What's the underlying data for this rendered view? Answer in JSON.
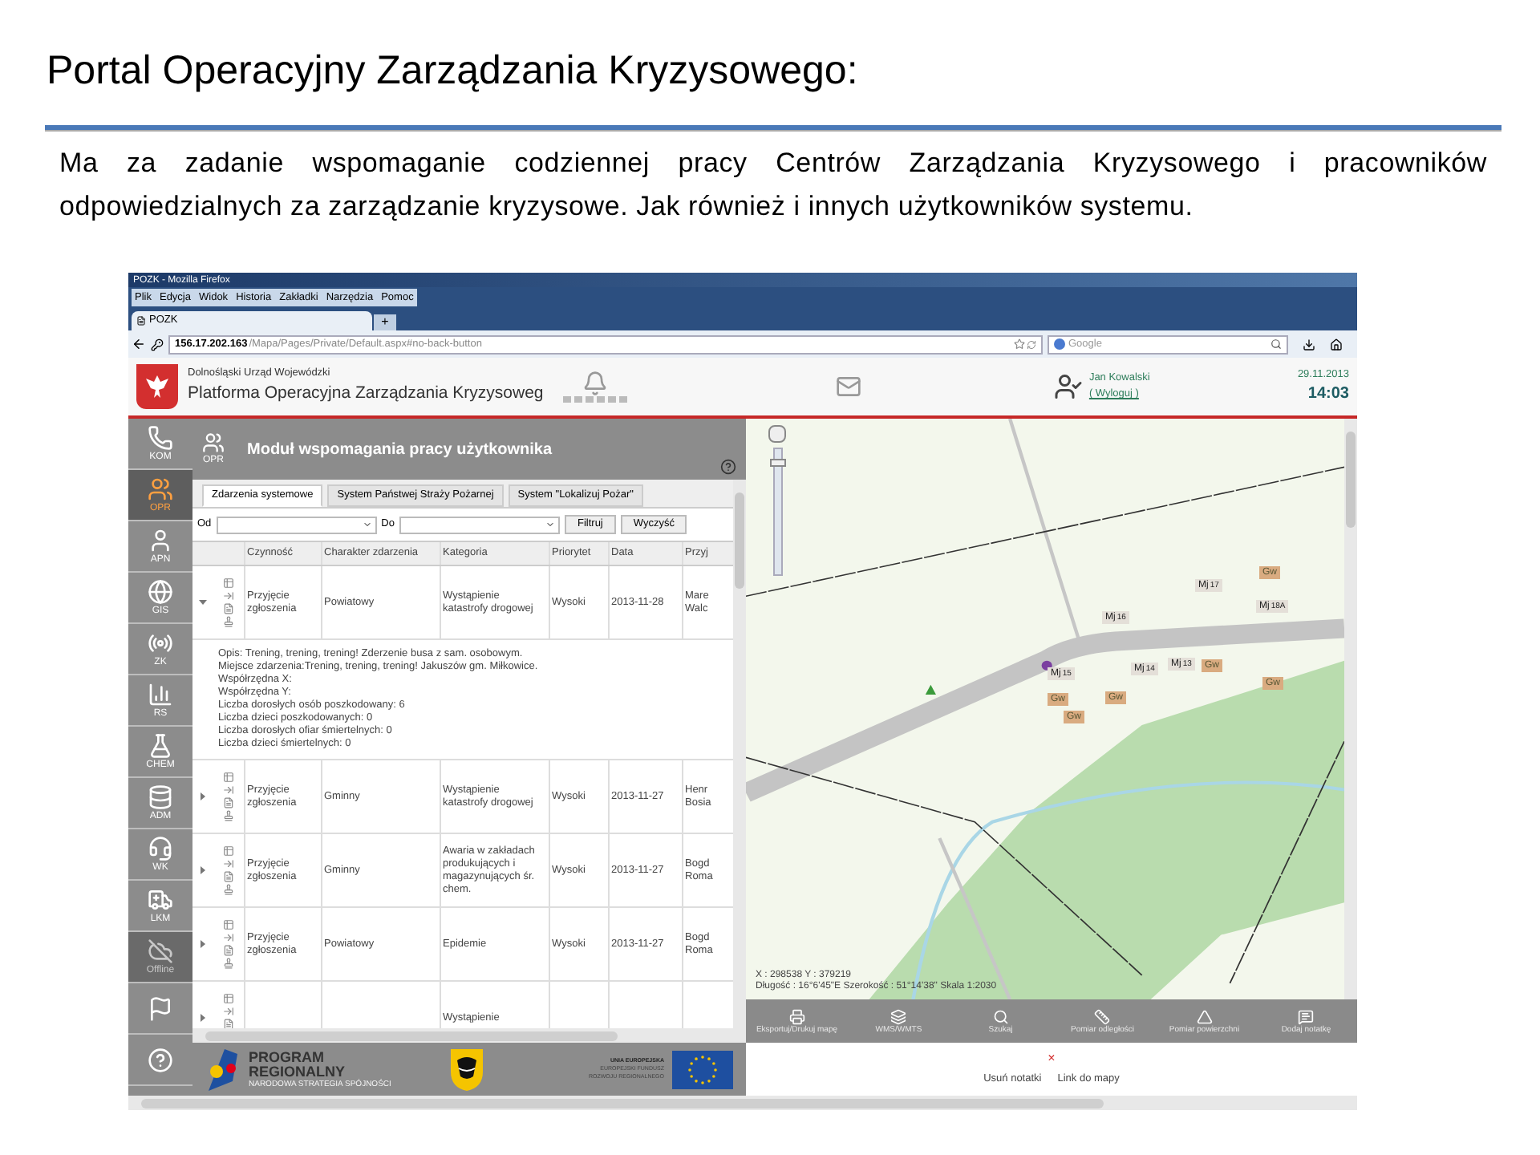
{
  "slide": {
    "title": "Portal Operacyjny Zarządzania Kryzysowego:",
    "paragraph": "Ma za zadanie wspomaganie codziennej pracy Centrów Zarządzania Kryzysowego i pracowników odpowiedzialnych za zarządzanie kryzysowe. Jak również i innych użytkowników systemu."
  },
  "browser": {
    "title": "POZK - Mozilla Firefox",
    "menu": [
      "Plik",
      "Edycja",
      "Widok",
      "Historia",
      "Zakładki",
      "Narzędzia",
      "Pomoc"
    ],
    "tab": "POZK",
    "new_tab": "+",
    "url_host": "156.17.202.163",
    "url_path": "/Mapa/Pages/Private/Default.aspx#no-back-button",
    "search_placeholder": "Google"
  },
  "header": {
    "org_words": [
      "Dolnośląski",
      "Urząd",
      "Wojewódzki"
    ],
    "platform_words": [
      "Platforma",
      "Operacyjna",
      "Zarządzania",
      "Kryzysoweg"
    ],
    "user": "Jan Kowalski",
    "logout": "( Wyloguj )",
    "date": "29.11.2013",
    "time": "14:03"
  },
  "sidebar": {
    "items": [
      {
        "label": "KOM",
        "selected": false,
        "disabled": false
      },
      {
        "label": "OPR",
        "selected": true,
        "disabled": false
      },
      {
        "label": "APN",
        "selected": false,
        "disabled": false
      },
      {
        "label": "GIS",
        "selected": false,
        "disabled": false
      },
      {
        "label": "ZK",
        "selected": false,
        "disabled": false
      },
      {
        "label": "RS",
        "selected": false,
        "disabled": false
      },
      {
        "label": "CHEM",
        "selected": false,
        "disabled": false
      },
      {
        "label": "ADM",
        "selected": false,
        "disabled": false
      },
      {
        "label": "WK",
        "selected": false,
        "disabled": false
      },
      {
        "label": "LKM",
        "selected": false,
        "disabled": false
      },
      {
        "label": "Offline",
        "selected": false,
        "disabled": true
      },
      {
        "selected": false,
        "disabled": false
      },
      {
        "selected": false,
        "disabled": false
      }
    ]
  },
  "module": {
    "icon_label": "OPR",
    "title": "Moduł wspomagania pracy użytkownika",
    "tabs": [
      {
        "label": "Zdarzenia systemowe",
        "selected": true
      },
      {
        "label": "System Państwej Straży Pożarnej",
        "selected": false
      },
      {
        "label": "System \"Lokalizuj Pożar\"",
        "selected": false
      }
    ],
    "filter": {
      "from_label": "Od",
      "to_label": "Do",
      "buttons": [
        "Filtruj",
        "Wyczyść"
      ]
    },
    "table": {
      "columns": [
        "Czynność",
        "Charakter zdarzenia",
        "Kategoria",
        "Priorytet",
        "Data",
        "Przyj"
      ],
      "rows": [
        {
          "expanded": true,
          "cells": [
            "Przyjęcie zgłoszenia",
            "Powiatowy",
            "Wystąpienie katastrofy drogowej",
            "Wysoki",
            "2013-11-28",
            "Mare Walc"
          ],
          "details": [
            "Opis: Trening, trening, trening! Zderzenie busa z sam. osobowym.",
            "Miejsce zdarzenia:Trening, trening, trening! Jakuszów gm. Miłkowice.",
            "Współrzędna X:",
            "Współrzędna Y:",
            "Liczba dorosłych osób poszkodowany: 6",
            "Liczba dzieci poszkodowanych: 0",
            "Liczba dorosłych ofiar śmiertelnych: 0",
            "Liczba dzieci śmiertelnych: 0"
          ]
        },
        {
          "expanded": false,
          "cells": [
            "Przyjęcie zgłoszenia",
            "Gminny",
            "Wystąpienie katastrofy drogowej",
            "Wysoki",
            "2013-11-27",
            "Henr Bosia"
          ]
        },
        {
          "expanded": false,
          "cells": [
            "Przyjęcie zgłoszenia",
            "Gminny",
            "Awaria w zakładach produkujących i magazynujących śr. chem.",
            "Wysoki",
            "2013-11-27",
            "Bogd Roma"
          ]
        },
        {
          "expanded": false,
          "cells": [
            "Przyjęcie zgłoszenia",
            "Powiatowy",
            "Epidemie",
            "Wysoki",
            "2013-11-27",
            "Bogd Roma"
          ]
        },
        {
          "expanded": false,
          "cells": [
            "",
            "",
            "Wystąpienie",
            "",
            "",
            ""
          ]
        }
      ]
    }
  },
  "footer": {
    "program": [
      "PROGRAM",
      "REGIONALNY"
    ],
    "program_sub": "NARODOWA STRATEGIA SPÓJNOŚCI",
    "eu": [
      "UNIA EUROPEJSKA",
      "EUROPEJSKI FUNDUSZ",
      "ROZWOJU REGIONALNEGO"
    ]
  },
  "map": {
    "zoom": {
      "level": 0.92
    },
    "buildings": [
      {
        "label": "Gw"
      },
      {
        "label": "Mj",
        "number": "17"
      },
      {
        "label": "Mj",
        "number": "18A"
      },
      {
        "label": "Mj",
        "number": "16"
      },
      {
        "label": "Mj",
        "number": "15"
      },
      {
        "label": "Mj",
        "number": "14"
      },
      {
        "label": "Mj",
        "number": "13"
      },
      {
        "label": "Gw"
      },
      {
        "label": "Gw"
      },
      {
        "label": "Gw"
      },
      {
        "label": "Gw"
      },
      {
        "label": "Gw"
      }
    ],
    "coords": [
      "X : 298538  Y : 379219",
      "Długość : 16°6'45\"E  Szerokość : 51°14'38\" Skala 1:2030"
    ],
    "tools": [
      "Eksportuj/Drukuj mapę",
      "WMS/WMTS",
      "Szukaj",
      "Pomiar odległości",
      "Pomiar powierzchni",
      "Dodaj notatkę"
    ],
    "close": "×",
    "links": [
      "Usuń notatki",
      "Link do mapy"
    ]
  }
}
